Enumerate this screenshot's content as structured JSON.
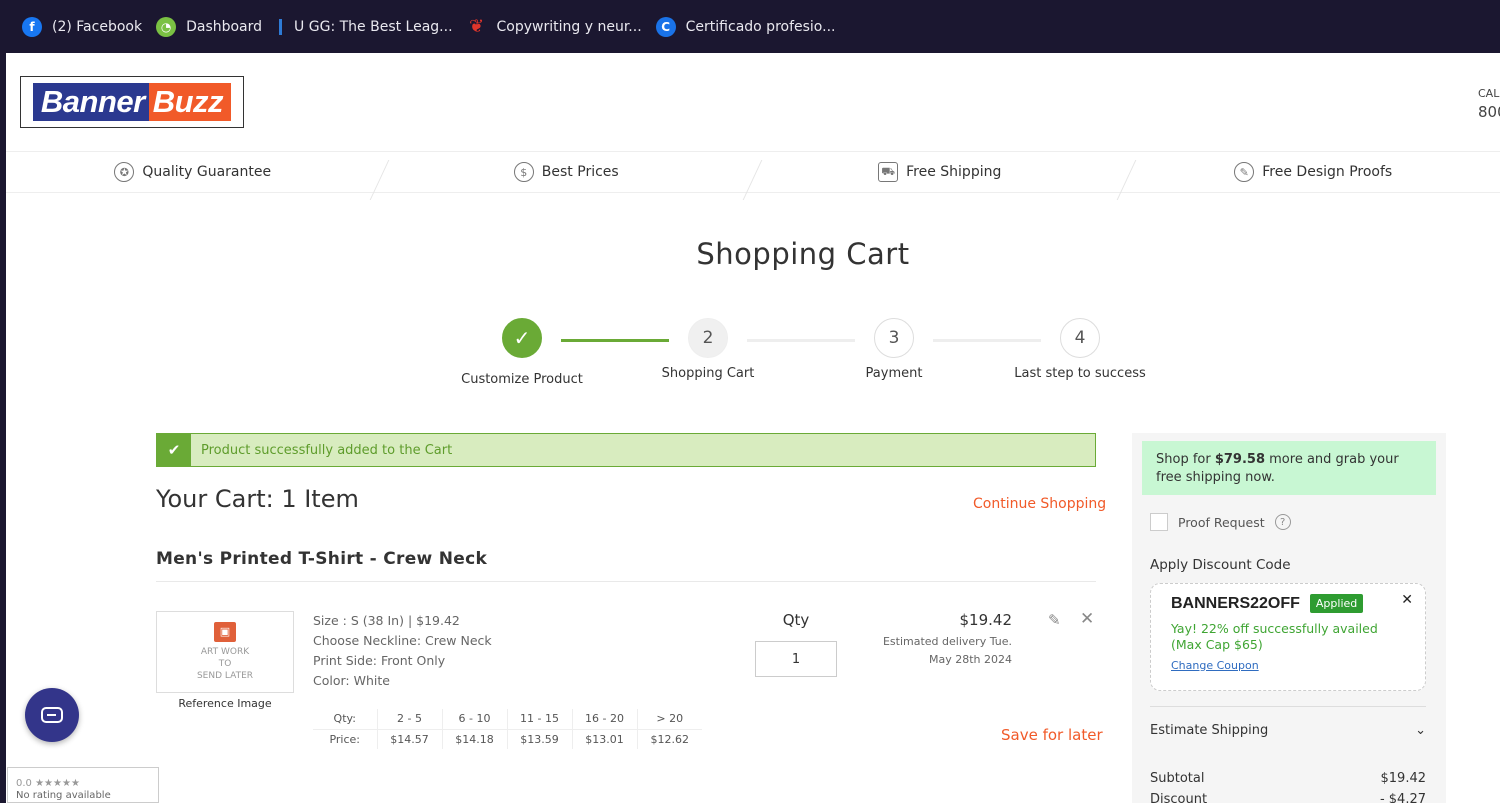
{
  "bookmarks": [
    {
      "label": "(2) Facebook",
      "icon": "facebook-icon"
    },
    {
      "label": "Dashboard",
      "icon": "dashboard-icon"
    },
    {
      "label": "U GG: The Best Leag...",
      "icon": "ugg-icon"
    },
    {
      "label": "Copywriting y neur...",
      "icon": "copywriting-icon"
    },
    {
      "label": "Certificado profesio...",
      "icon": "certificate-icon"
    }
  ],
  "logo": {
    "part1": "Banner",
    "part2": "Buzz"
  },
  "header": {
    "call_label": "CALL",
    "call_number": "800"
  },
  "features": [
    {
      "label": "Quality Guarantee",
      "icon": "award-icon"
    },
    {
      "label": "Best Prices",
      "icon": "dollar-icon"
    },
    {
      "label": "Free Shipping",
      "icon": "truck-icon"
    },
    {
      "label": "Free Design Proofs",
      "icon": "palette-icon"
    }
  ],
  "page_title": "Shopping Cart",
  "steps": [
    {
      "number": "✓",
      "label": "Customize Product",
      "state": "done"
    },
    {
      "number": "2",
      "label": "Shopping Cart",
      "state": "current"
    },
    {
      "number": "3",
      "label": "Payment",
      "state": "pending"
    },
    {
      "number": "4",
      "label": "Last step to success",
      "state": "pending"
    }
  ],
  "alert": {
    "message": "Product successfully added to the Cart"
  },
  "cart": {
    "heading": "Your Cart: 1 Item",
    "continue_label": "Continue Shopping",
    "item": {
      "name": "Men's Printed T-Shirt - Crew Neck",
      "thumb_text": [
        "ART WORK",
        "TO",
        "SEND LATER"
      ],
      "reference_label": "Reference Image",
      "specs": [
        "Size : S (38 In) | $19.42",
        "Choose Neckline: Crew Neck",
        "Print Side: Front Only",
        "Color: White"
      ],
      "qty_label": "Qty",
      "qty_value": "1",
      "price": "$19.42",
      "delivery_line1": "Estimated delivery Tue.",
      "delivery_line2": "May 28th 2024",
      "save_later": "Save for later",
      "tiers": {
        "qty_label": "Qty:",
        "price_label": "Price:",
        "ranges": [
          "2 - 5",
          "6 - 10",
          "11 - 15",
          "16 - 20",
          "> 20"
        ],
        "prices": [
          "$14.57",
          "$14.18",
          "$13.59",
          "$13.01",
          "$12.62"
        ]
      }
    }
  },
  "sidebar": {
    "ship_pre": "Shop for ",
    "ship_amount": "$79.58",
    "ship_post": " more and grab your free shipping now.",
    "proof_label": "Proof Request",
    "apply_label": "Apply Discount Code",
    "coupon_code": "BANNERS22OFF",
    "coupon_status": "Applied",
    "coupon_message": "Yay! 22% off successfully availed (Max Cap $65)",
    "change_coupon": "Change Coupon",
    "estimate_shipping": "Estimate Shipping",
    "subtotal_label": "Subtotal",
    "subtotal_value": "$19.42",
    "discount_label": "Discount",
    "discount_value": "- $4.27"
  },
  "rating_widget": {
    "stars": "0.0 ★★★★★",
    "text": "No rating available"
  },
  "colors": {
    "accent": "#f15a29",
    "success": "#6aaa36",
    "brand_blue": "#2b3990"
  }
}
